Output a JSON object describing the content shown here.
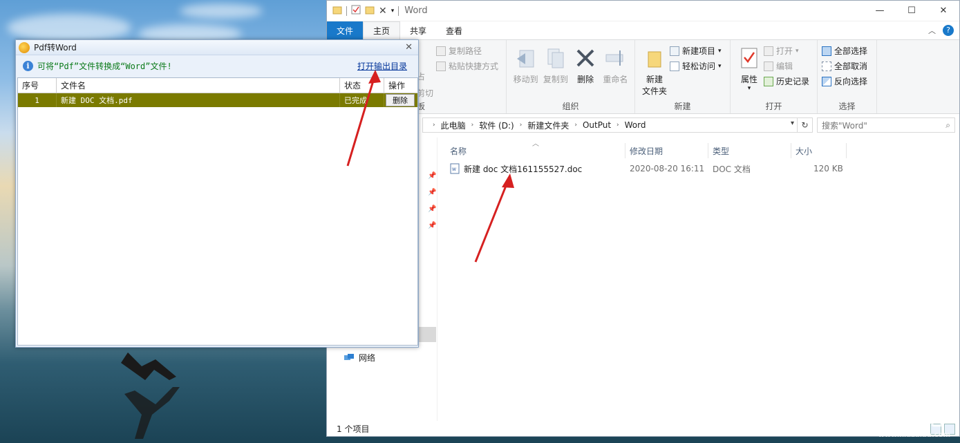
{
  "explorer": {
    "title": "Word",
    "tabs": [
      "文件",
      "主页",
      "共享",
      "查看"
    ],
    "active_tab": "主页",
    "window_buttons": [
      "—",
      "☐",
      "✕"
    ],
    "ribbon": {
      "clipboard": {
        "copy_path": "复制路径",
        "paste_shortcut": "粘贴快捷方式",
        "cut_partial": "剪切",
        "paste_partial": "占",
        "label_partial": "板"
      },
      "organize": {
        "move_to": "移动到",
        "copy_to": "复制到",
        "delete": "删除",
        "rename": "重命名",
        "label": "组织"
      },
      "new": {
        "new_folder_line1": "新建",
        "new_folder_line2": "文件夹",
        "new_item": "新建项目",
        "easy_access": "轻松访问",
        "label": "新建"
      },
      "open": {
        "properties": "属性",
        "open": "打开",
        "edit": "编辑",
        "history": "历史记录",
        "label": "打开"
      },
      "select": {
        "select_all": "全部选择",
        "select_none": "全部取消",
        "invert": "反向选择",
        "label": "选择"
      }
    },
    "address": [
      "此电脑",
      "软件 (D:)",
      "新建文件夹",
      "OutPut",
      "Word"
    ],
    "search_placeholder": "搜索\"Word\"",
    "columns": [
      "名称",
      "修改日期",
      "类型",
      "大小"
    ],
    "files": [
      {
        "name": "新建 doc 文档161155527.doc",
        "modified": "2020-08-20 16:11",
        "type": "DOC 文档",
        "size": "120 KB"
      }
    ],
    "nav": {
      "network": "网络"
    },
    "status": "1 个项目"
  },
  "dialog": {
    "title": "Pdf转Word",
    "info": "可将“Pdf”文件转换成“Word”文件!",
    "open_output": "打开输出目录",
    "columns": [
      "序号",
      "文件名",
      "状态",
      "操作"
    ],
    "rows": [
      {
        "index": "1",
        "filename": "新建 DOC 文档.pdf",
        "status": "已完成",
        "action": "删除"
      }
    ]
  },
  "colors": {
    "accent": "#1979ca",
    "row_highlight": "#7a7a00",
    "arrow": "#d62020"
  },
  "watermark": {
    "text": "下载吧",
    "sub": "www.xiazaiba.com"
  }
}
